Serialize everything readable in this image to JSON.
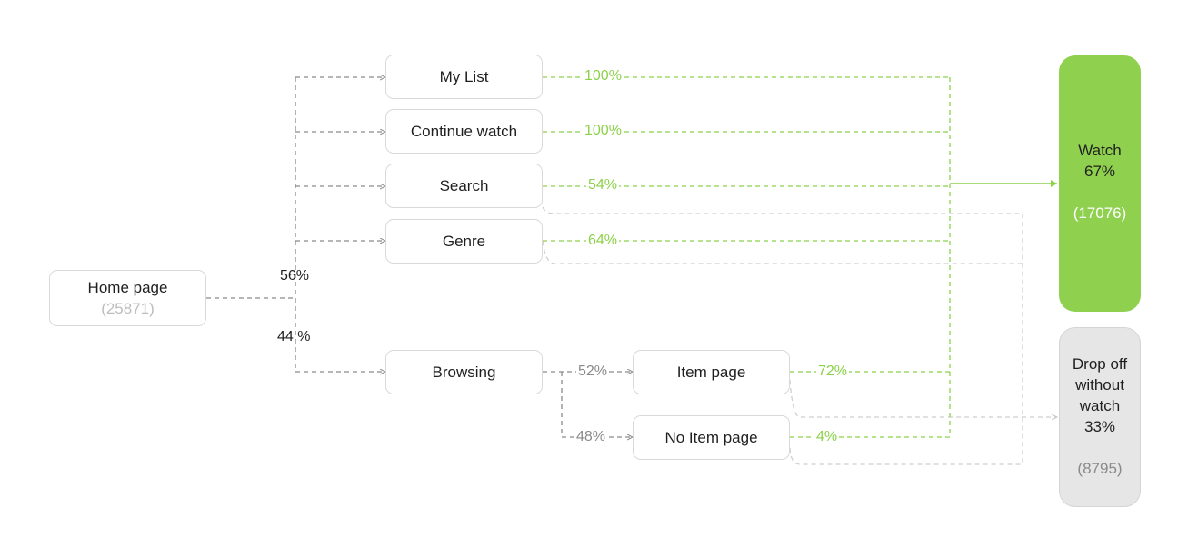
{
  "home": {
    "label": "Home page",
    "count": "(25871)"
  },
  "split": {
    "top": "56%",
    "bottom": "44 %"
  },
  "sources": [
    {
      "label": "My List",
      "watch_pct": "100%"
    },
    {
      "label": "Continue watch",
      "watch_pct": "100%"
    },
    {
      "label": "Search",
      "watch_pct": "54%"
    },
    {
      "label": "Genre",
      "watch_pct": "64%"
    }
  ],
  "browsing": {
    "label": "Browsing",
    "item_page": {
      "label": "Item page",
      "split_pct": "52%",
      "watch_pct": "72%"
    },
    "no_item_page": {
      "label": "No Item page",
      "split_pct": "48%",
      "watch_pct": "4%"
    }
  },
  "outcomes": {
    "watch": {
      "label": "Watch",
      "pct": "67%",
      "count": "(17076)"
    },
    "drop": {
      "label_line1": "Drop off",
      "label_line2": "without",
      "label_line3": "watch",
      "pct": "33%",
      "count": "(8795)"
    }
  },
  "colors": {
    "green": "#8cd14a",
    "watch_fill": "#8fd14f",
    "drop_fill": "#e6e6e6",
    "gray_line": "#8a8a8a",
    "light_line": "#cfcfcf"
  }
}
